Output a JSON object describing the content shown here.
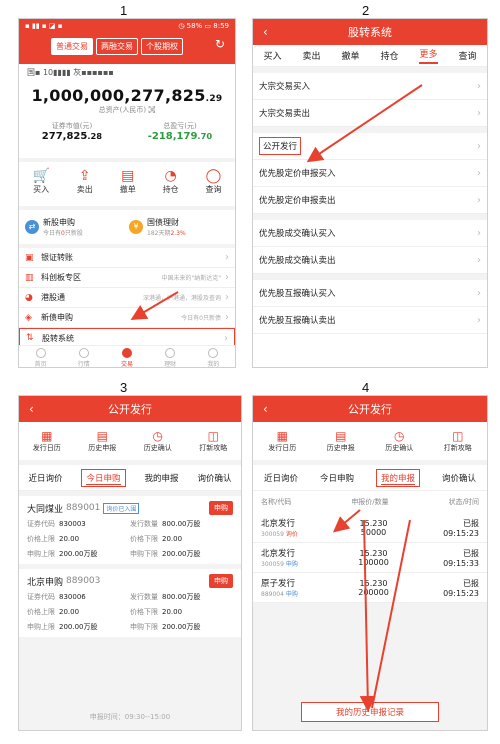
{
  "panel_numbers": [
    "1",
    "2",
    "3",
    "4"
  ],
  "p1": {
    "status_left": "▪ ▮▮ ▪ ◪ ▪",
    "status_right": "◷ 58% ▭ 8:59",
    "tabs": [
      "普通交易",
      "两融交易",
      "个股期权"
    ],
    "account": "国▪ 10▮▮▮▮ 灰▪▪▪▪▪▪",
    "total_asset_int": "1,000,000,277,825",
    "total_asset_dec": ".29",
    "total_asset_label": "总资产(人民币) ㉊",
    "market_label": "证券市值(元)",
    "market_int": "277,825",
    "market_dec": ".28",
    "pnl_label": "总盈亏(元)",
    "pnl_int": "-218,179",
    "pnl_dec": ".70",
    "icons": [
      {
        "label": "买入",
        "icon": "cart-icon"
      },
      {
        "label": "卖出",
        "icon": "cart-out-icon"
      },
      {
        "label": "撤单",
        "icon": "doc-icon"
      },
      {
        "label": "持仓",
        "icon": "pie-icon"
      },
      {
        "label": "查询",
        "icon": "chat-icon"
      }
    ],
    "card1_title": "新股申购",
    "card1_sub_a": "今日有",
    "card1_sub_hl": "0",
    "card1_sub_b": "只新股",
    "card2_title": "国债理财",
    "card2_sub_a": "182天期",
    "card2_sub_hl": "2.3%",
    "list": [
      {
        "label": "银证转账",
        "note": ""
      },
      {
        "label": "科创板专区",
        "note": "中国未来的\"纳斯达克\""
      },
      {
        "label": "港股通",
        "note": "深港通，沪港通，港股及查询"
      },
      {
        "label": "新债申购",
        "note": "今日有0只新债"
      },
      {
        "label": "股转系统",
        "note": ""
      }
    ],
    "bottom_nav": [
      "首页",
      "行情",
      "交易",
      "理财",
      "我的"
    ]
  },
  "p2": {
    "title": "股转系统",
    "tabs": [
      "买入",
      "卖出",
      "撤单",
      "持仓",
      "更多",
      "查询"
    ],
    "active_tab": "更多",
    "items": [
      "大宗交易买入",
      "大宗交易卖出",
      "公开发行",
      "优先股定价申报买入",
      "优先股定价申报卖出",
      "优先股成交确认买入",
      "优先股成交确认卖出",
      "优先股互报确认买入",
      "优先股互报确认卖出"
    ]
  },
  "p3": {
    "title": "公开发行",
    "quick": [
      {
        "label": "发行日历",
        "icon": "calendar-icon"
      },
      {
        "label": "历史申报",
        "icon": "history-doc-icon"
      },
      {
        "label": "历史确认",
        "icon": "clock-icon"
      },
      {
        "label": "打新攻略",
        "icon": "book-icon"
      }
    ],
    "subtabs": [
      "近日询价",
      "今日申购",
      "我的申报",
      "询价确认"
    ],
    "ipos": [
      {
        "name": "大同煤业",
        "code": "889001",
        "tag": "询价已入围",
        "btn": "申购",
        "fields": [
          [
            "证券代码",
            "830003"
          ],
          [
            "发行数量",
            "800.00万股"
          ],
          [
            "价格上限",
            "20.00"
          ],
          [
            "价格下限",
            "20.00"
          ],
          [
            "申购上限",
            "200.00万股"
          ],
          [
            "申购下限",
            "200.00万股"
          ]
        ]
      },
      {
        "name": "北京申购",
        "code": "889003",
        "tag": "",
        "btn": "申购",
        "fields": [
          [
            "证券代码",
            "830006"
          ],
          [
            "发行数量",
            "800.00万股"
          ],
          [
            "价格上限",
            "20.00"
          ],
          [
            "价格下限",
            "20.00"
          ],
          [
            "申购上限",
            "200.00万股"
          ],
          [
            "申购下限",
            "200.00万股"
          ]
        ]
      }
    ],
    "footer": "申报时间：09:30--15:00"
  },
  "p4": {
    "title": "公开发行",
    "subtabs": [
      "近日询价",
      "今日申购",
      "我的申报",
      "询价确认"
    ],
    "head": [
      "名称/代码",
      "申报价/数量",
      "状态/时间"
    ],
    "records": [
      {
        "name": "北京发行",
        "code": "300059",
        "tag": "询价",
        "price": "15.230",
        "qty": "50000",
        "status": "已报",
        "time": "09:15:23"
      },
      {
        "name": "北京发行",
        "code": "300059",
        "tag": "申购",
        "price": "15.230",
        "qty": "100000",
        "status": "已报",
        "time": "09:15:33"
      },
      {
        "name": "原子发行",
        "code": "889004",
        "tag": "申购",
        "price": "15.230",
        "qty": "200000",
        "status": "已报",
        "time": "09:15:23"
      }
    ],
    "history_btn": "我的历史申报记录"
  },
  "colors": {
    "brand": "#e8412f",
    "up": "#e8412f",
    "down": "#2a9d3e"
  }
}
